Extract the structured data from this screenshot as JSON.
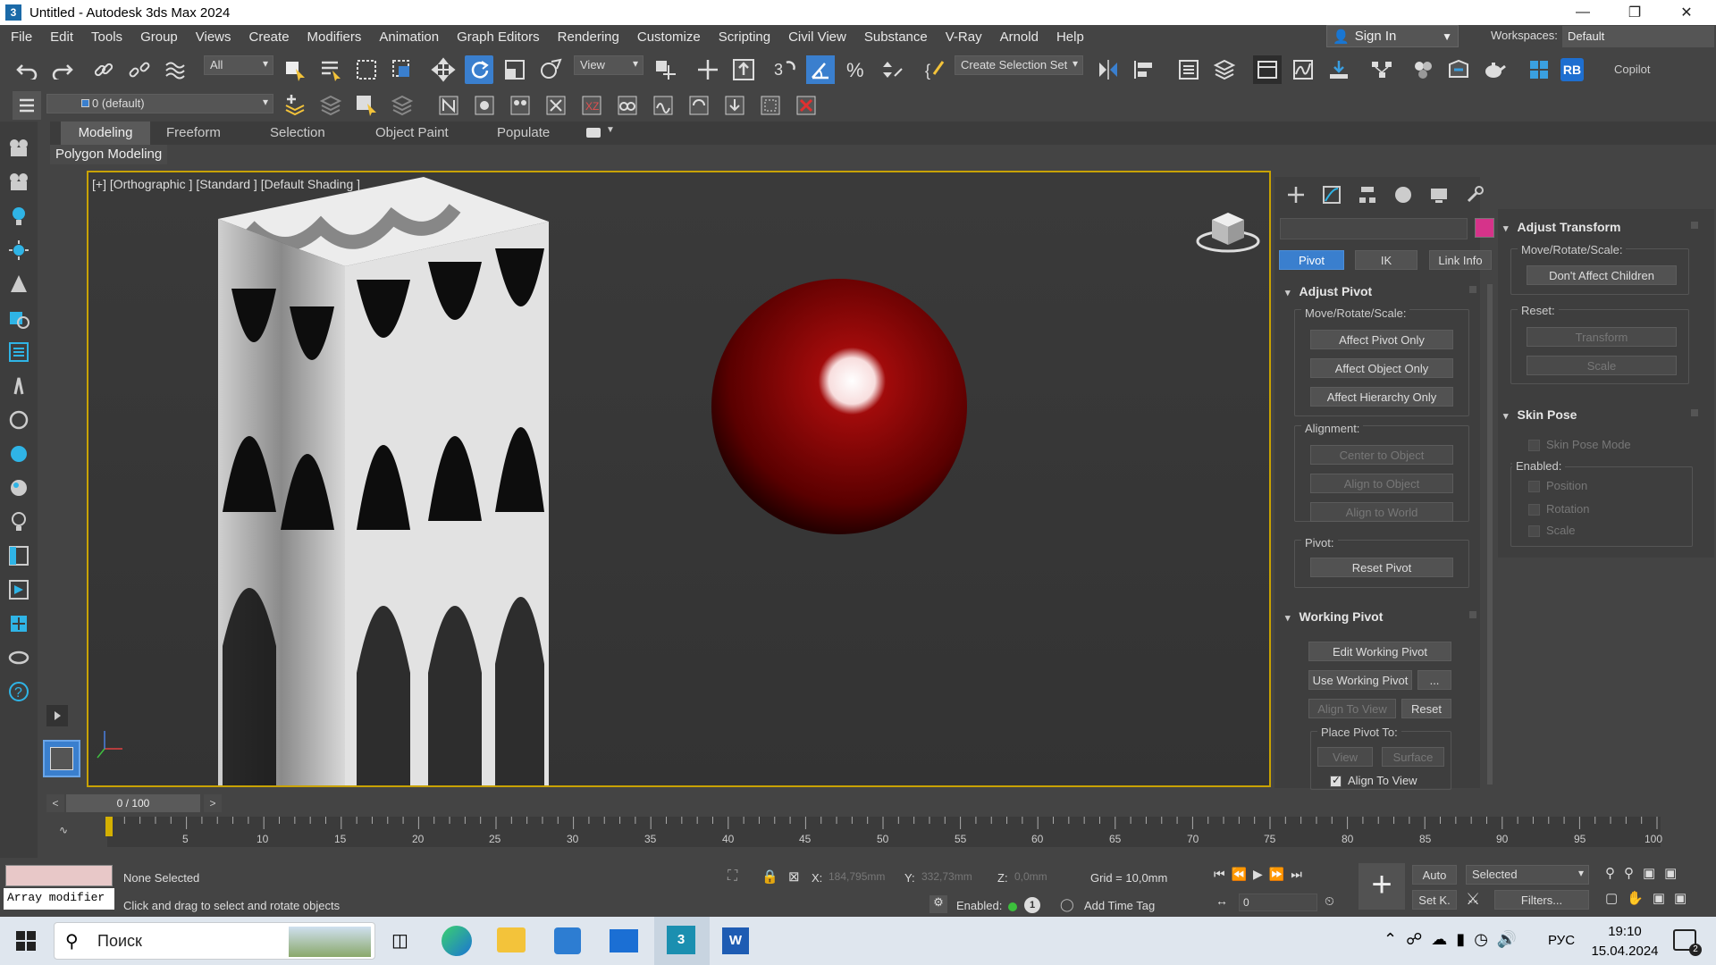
{
  "window": {
    "title": "Untitled - Autodesk 3ds Max 2024",
    "app_icon": "3"
  },
  "menu": [
    "File",
    "Edit",
    "Tools",
    "Group",
    "Views",
    "Create",
    "Modifiers",
    "Animation",
    "Graph Editors",
    "Rendering",
    "Customize",
    "Scripting",
    "Civil View",
    "Substance",
    "V-Ray",
    "Arnold",
    "Help"
  ],
  "signin": {
    "label": "Sign In"
  },
  "workspaces": {
    "label": "Workspaces:",
    "value": "Default"
  },
  "toolbar": {
    "filter": "All",
    "refcoord": "View",
    "selection_set": "Create Selection Set",
    "layer": "0 (default)",
    "copilot": "Copilot",
    "rb": "RB"
  },
  "ribbon": {
    "tabs": [
      "Modeling",
      "Freeform",
      "Selection",
      "Object Paint",
      "Populate"
    ],
    "active": "Modeling",
    "panel_label": "Polygon Modeling"
  },
  "viewport": {
    "label": "[+] [Orthographic ] [Standard ] [Default Shading ]"
  },
  "cmd": {
    "color_swatch": "#d6338a",
    "tabs": [
      "Pivot",
      "IK",
      "Link Info"
    ],
    "adjust_pivot": {
      "title": "Adjust Pivot",
      "mrs": "Move/Rotate/Scale:",
      "btns": [
        "Affect Pivot Only",
        "Affect Object Only",
        "Affect Hierarchy Only"
      ],
      "alignment": "Alignment:",
      "align_btns": [
        "Center to Object",
        "Align to Object",
        "Align to World"
      ],
      "pivot": "Pivot:",
      "reset_pivot": "Reset Pivot"
    },
    "working_pivot": {
      "title": "Working Pivot",
      "edit": "Edit Working Pivot",
      "use": "Use Working Pivot",
      "more": "...",
      "align_to_view": "Align To View",
      "reset": "Reset",
      "place_to": "Place Pivot To:",
      "view": "View",
      "surface": "Surface",
      "align_check": "Align To View"
    }
  },
  "rpanel": {
    "adjust_transform": {
      "title": "Adjust Transform",
      "mrs": "Move/Rotate/Scale:",
      "dont": "Don't Affect Children",
      "reset": "Reset:",
      "transform": "Transform",
      "scale": "Scale"
    },
    "skin_pose": {
      "title": "Skin Pose",
      "mode": "Skin Pose Mode",
      "enabled": "Enabled:",
      "position": "Position",
      "rotation": "Rotation",
      "scale": "Scale"
    }
  },
  "timeline": {
    "frame": "0 / 100",
    "prev": "<",
    "next": ">",
    "ticks": [
      "5",
      "10",
      "15",
      "20",
      "25",
      "30",
      "35",
      "40",
      "45",
      "50",
      "55",
      "60",
      "65",
      "70",
      "75",
      "80",
      "85",
      "90",
      "95",
      "100"
    ]
  },
  "status": {
    "maxscript": "Array modifier",
    "selected": "None Selected",
    "prompt": "Click and drag to select and rotate objects",
    "x_label": "X:",
    "x": "184,795mm",
    "y_label": "Y:",
    "y": "332,73mm",
    "z_label": "Z:",
    "z": "0,0mm",
    "grid": "Grid = 10,0mm",
    "enabled": "Enabled:",
    "add_time_tag": "Add Time Tag",
    "auto": "Auto",
    "setk": "Set K.",
    "key_mode": "Selected",
    "filters": "Filters...",
    "frame_field": "0"
  },
  "taskbar": {
    "search": "Поиск",
    "lang": "РУС",
    "time": "19:10",
    "date": "15.04.2024",
    "notif": "2"
  }
}
